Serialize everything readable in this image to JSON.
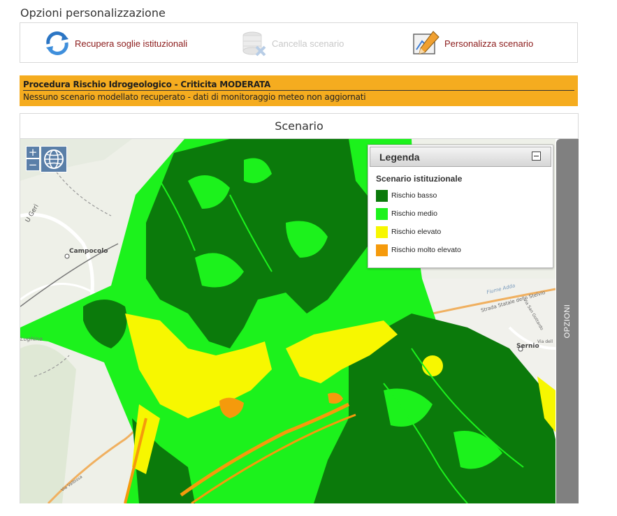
{
  "section": {
    "title": "Opzioni personalizzazione"
  },
  "toolbar": {
    "recupera_label": "Recupera soglie istituzionali",
    "cancella_label": "Cancella scenario",
    "personalizza_label": "Personalizza scenario"
  },
  "alert": {
    "title": "Procedura Rischio Idrogeologico - Criticita MODERATA",
    "message": "Nessuno scenario modellato recuperato - dati di monitoraggio meteo non aggiornati"
  },
  "panel": {
    "title": "Scenario"
  },
  "map": {
    "zoom_in": "+",
    "zoom_out": "−",
    "place_labels": [
      "Campocolo",
      "Sernio",
      "Lughina",
      "Fiume Adda",
      "Strada Statale dello Stelvio",
      "Via San Gottardo",
      "Via dell",
      "Via Valbissa",
      "U Geri"
    ]
  },
  "legend": {
    "title": "Legenda",
    "subtitle": "Scenario istituzionale",
    "items": [
      {
        "label": "Rischio basso",
        "color": "#0b7a0b"
      },
      {
        "label": "Rischio medio",
        "color": "#1cf21c"
      },
      {
        "label": "Rischio elevato",
        "color": "#f7f700"
      },
      {
        "label": "Rischio molto elevato",
        "color": "#f59a0c"
      }
    ]
  },
  "side_tab": {
    "label": "OPZIONI"
  },
  "colors": {
    "alert_bg": "#f5ac1f",
    "link_text": "#8b1a1a",
    "disabled_text": "#c8c8c8",
    "tab_bg": "#808080"
  }
}
